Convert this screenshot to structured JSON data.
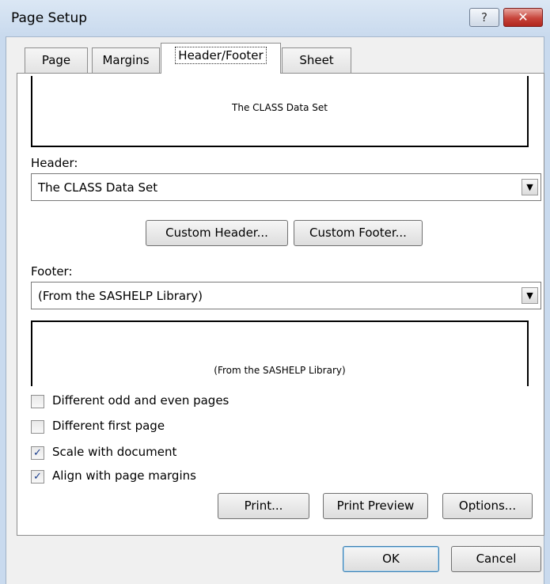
{
  "window": {
    "title": "Page Setup",
    "help_glyph": "?",
    "close_glyph": "✕"
  },
  "tabs": [
    {
      "label": "Page",
      "active": false
    },
    {
      "label": "Margins",
      "active": false
    },
    {
      "label": "Header/Footer",
      "active": true
    },
    {
      "label": "Sheet",
      "active": false
    }
  ],
  "header": {
    "preview_text": "The CLASS Data Set",
    "label": "Header:",
    "value": "The CLASS Data Set"
  },
  "buttons": {
    "custom_header": "Custom Header...",
    "custom_footer": "Custom Footer...",
    "print": "Print...",
    "print_preview": "Print Preview",
    "options": "Options...",
    "ok": "OK",
    "cancel": "Cancel"
  },
  "footer": {
    "label": "Footer:",
    "value": "(From the SASHELP Library)",
    "preview_text": "(From the SASHELP Library)"
  },
  "options": [
    {
      "label": "Different odd and even pages",
      "checked": false
    },
    {
      "label": "Different first page",
      "checked": false
    },
    {
      "label": "Scale with document",
      "checked": true
    },
    {
      "label": "Align with page margins",
      "checked": true
    }
  ],
  "icons": {
    "dropdown_arrow": "▼",
    "checkmark": "✓"
  }
}
